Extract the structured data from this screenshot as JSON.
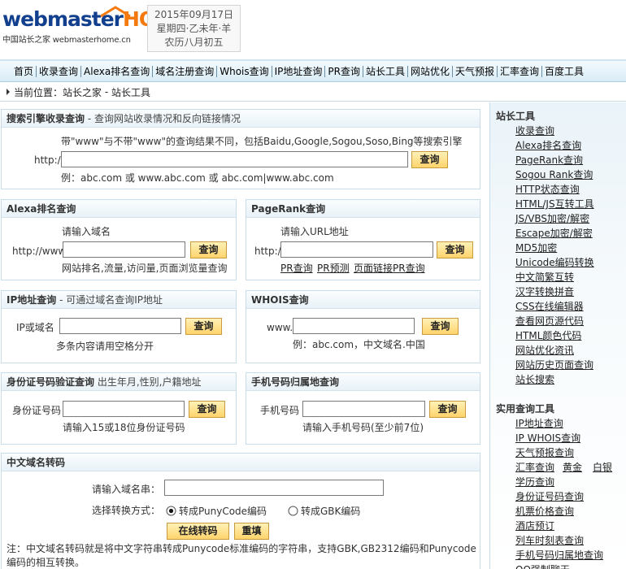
{
  "header": {
    "logo_main": "webmaster",
    "logo_home": "HOME",
    "logo_sub": "中国站长之家 webmasterhome.cn",
    "date_line1": "2015年09月17日",
    "date_line2": "星期四·乙未年·羊",
    "date_line3": "农历八月初五"
  },
  "nav": {
    "items": [
      "首页",
      "收录查询",
      "Alexa排名查询",
      "域名注册查询",
      "Whois查询",
      "IP地址查询",
      "PR查询",
      "站长工具",
      "网站优化",
      "天气预报",
      "汇率查询",
      "百度工具"
    ]
  },
  "breadcrumb": {
    "prefix": "当前位置：",
    "home": "站长之家",
    "sep": " - ",
    "current": "站长工具"
  },
  "search_engine": {
    "title": "搜索引擎收录查询",
    "desc": " - 查询网站收录情况和反向链接情况",
    "note": "带\"www\"与不带\"www\"的查询结果不同，包括Baidu,Google,Sogou,Soso,Bing等搜索引擎",
    "prefix": "http://",
    "value": "",
    "button": "查询",
    "example": "例：abc.com 或 www.abc.com 或 abc.com|www.abc.com"
  },
  "alexa": {
    "title": "Alexa排名查询",
    "hint": "请输入域名",
    "prefix": "http://www.",
    "value": "",
    "button": "查询",
    "note": "网站排名,流量,访问量,页面浏览量查询"
  },
  "pagerank": {
    "title": "PageRank查询",
    "hint": "请输入URL地址",
    "prefix": "http://",
    "value": "",
    "button": "查询",
    "links": [
      "PR查询",
      "PR预测",
      "页面链接PR查询"
    ]
  },
  "ip": {
    "title": "IP地址查询",
    "desc": " - 可通过域名查询IP地址",
    "label": "IP或域名",
    "value": "",
    "button": "查询",
    "note": "多条内容请用空格分开"
  },
  "whois": {
    "title": "WHOIS查询",
    "prefix": "www.",
    "value": "",
    "button": "查询",
    "example": "例：abc.com，中文域名.中国"
  },
  "idcard": {
    "title": "身份证号码验证查询",
    "desc": " 出生年月,性别,户籍地址",
    "label": "身份证号码",
    "value": "",
    "button": "查询",
    "note": "请输入15或18位身份证号码"
  },
  "mobile": {
    "title": "手机号码归属地查询",
    "label": "手机号码",
    "value": "",
    "button": "查询",
    "note": "请输入手机号码(至少前7位)"
  },
  "idn": {
    "title": "中文域名转码",
    "label": "请输入域名串：",
    "value": "",
    "mode_label": "选择转换方式：",
    "opt1": "转成PunyCode编码",
    "opt2": "转成GBK编码",
    "selected": "转成PunyCode编码",
    "convert_button": "在线转码",
    "reset_button": "重填",
    "note": "注：中文域名转码就是将中文字符串转成Punycode标准编码的字符串，支持GBK,GB2312编码和Punycode编码的相互转换。"
  },
  "sidebar": {
    "tools_title": "站长工具",
    "tools": [
      "收录查询",
      "Alexa排名查询",
      "PageRank查询",
      "Sogou Rank查询",
      "HTTP状态查询",
      "HTML/JS互转工具",
      "JS/VBS加密/解密",
      "Escape加密/解密",
      "MD5加密",
      "Unicode编码转换",
      "中文简繁互转",
      "汉字转换拼音",
      "CSS在线编辑器",
      "查看网页源代码",
      "HTML颜色代码",
      "网站优化资讯",
      "网站历史页面查询",
      "站长搜索"
    ],
    "practical_title": "实用查询工具",
    "practical": [
      "IP地址查询",
      "IP WHOIS查询",
      "天气预报查询",
      "汇率查询",
      "学历查询",
      "身份证号码查询",
      "机票价格查询",
      "酒店预订",
      "列车时刻表查询",
      "手机号码归属地查询",
      "QQ强制聊天"
    ],
    "gold": "黄金",
    "silver": "白银"
  }
}
